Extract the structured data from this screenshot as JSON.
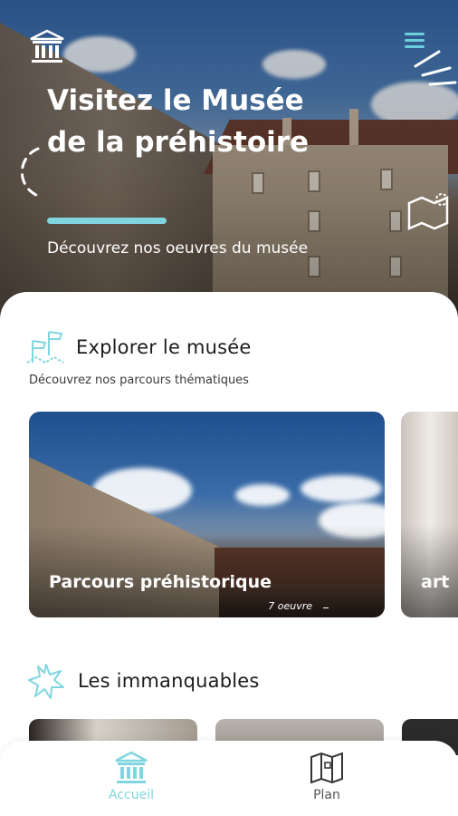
{
  "hero": {
    "title": "Visitez le Musée de la préhistoire",
    "subtitle": "Découvrez nos oeuvres du musée"
  },
  "explore": {
    "title": "Explorer le musée",
    "subtitle": "Découvrez nos parcours thématiques",
    "cards": [
      {
        "title": "Parcours préhistorique",
        "count": "7 oeuvre"
      },
      {
        "title": "art"
      }
    ]
  },
  "must_see": {
    "title": "Les immanquables"
  },
  "nav": {
    "items": [
      {
        "label": "Accueil",
        "icon": "museum-icon",
        "active": true
      },
      {
        "label": "Plan",
        "icon": "map-icon",
        "active": false
      }
    ]
  },
  "colors": {
    "accent": "#7fd6e0",
    "text": "#1c1c1c"
  }
}
